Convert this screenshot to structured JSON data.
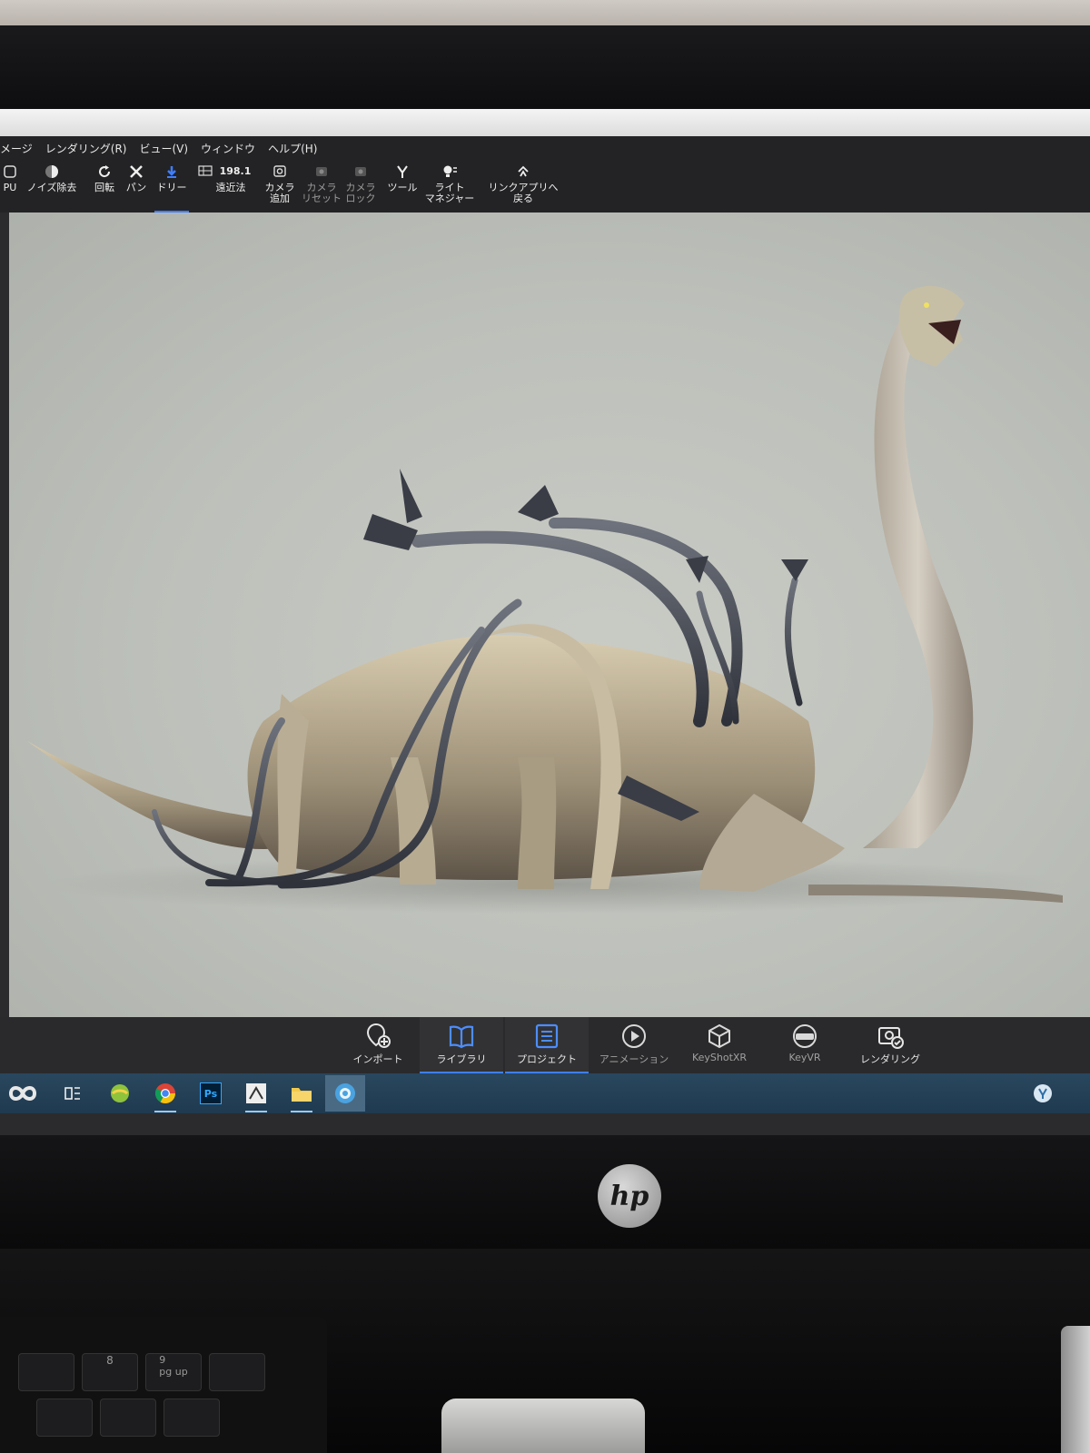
{
  "menubar": {
    "items": [
      "メージ",
      "レンダリング(R)",
      "ビュー(V)",
      "ウィンドウ",
      "ヘルプ(H)"
    ]
  },
  "toolbar": {
    "tools": [
      {
        "label": "PU",
        "icon": "gpu-icon"
      },
      {
        "label": "ノイズ除去",
        "icon": "denoise-icon"
      },
      {
        "label": "回転",
        "icon": "rotate-icon"
      },
      {
        "label": "パン",
        "icon": "pan-icon"
      },
      {
        "label": "ドリー",
        "icon": "dolly-icon",
        "active": true
      },
      {
        "label": "遠近法",
        "icon": "perspective-icon",
        "value": "198.1"
      },
      {
        "label": "カメラ\n追加",
        "icon": "add-camera-icon"
      },
      {
        "label": "カメラ\nリセット",
        "icon": "reset-camera-icon",
        "dim": true
      },
      {
        "label": "カメラ\nロック",
        "icon": "lock-camera-icon",
        "dim": true
      },
      {
        "label": "ツール",
        "icon": "tools-icon"
      },
      {
        "label": "ライト\nマネジャー",
        "icon": "light-manager-icon"
      },
      {
        "label": "リンクアプリへ\n戻る",
        "icon": "link-app-icon"
      }
    ]
  },
  "dock": {
    "buttons": [
      {
        "label": "インポート",
        "icon": "import-icon"
      },
      {
        "label": "ライブラリ",
        "icon": "library-icon",
        "selected": true
      },
      {
        "label": "プロジェクト",
        "icon": "project-icon",
        "selected": true
      },
      {
        "label": "アニメーション",
        "icon": "animation-icon"
      },
      {
        "label": "KeyShotXR",
        "icon": "keyshotxr-icon"
      },
      {
        "label": "KeyVR",
        "icon": "keyvr-icon"
      },
      {
        "label": "レンダリング",
        "icon": "render-icon"
      }
    ]
  },
  "taskbar": {
    "icons": [
      "keyshot-start-icon",
      "task-view-icon",
      "app-icon",
      "chrome-icon",
      "photoshop-icon",
      "zbrush-icon",
      "file-explorer-icon",
      "keyshot-icon"
    ],
    "photoshop_label": "Ps"
  },
  "monitor": {
    "brand": "hp"
  },
  "keyboard": {
    "keys": [
      "9\npg up",
      "8"
    ]
  },
  "colors": {
    "accent": "#3f7fff",
    "viewport_bg": "#c4c7c1",
    "toolbar_bg": "#232325",
    "taskbar_bg": "#24425a"
  }
}
